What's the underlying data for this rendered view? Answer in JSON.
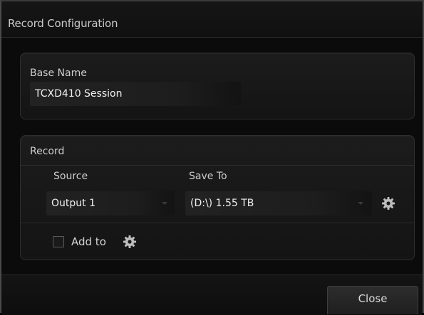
{
  "window": {
    "title": "Record Configuration"
  },
  "base_name": {
    "label": "Base Name",
    "value": "TCXD410 Session"
  },
  "record": {
    "section_label": "Record",
    "source": {
      "label": "Source",
      "value": "Output 1"
    },
    "save_to": {
      "label": "Save To",
      "value": "(D:\\) 1.55 TB"
    },
    "settings_icon": "gear-icon",
    "add_to": {
      "label": "Add to",
      "checked": false,
      "settings_icon": "gear-icon"
    }
  },
  "footer": {
    "close_label": "Close"
  },
  "colors": {
    "background": "#0b0b0b",
    "panel": "#1a1a1a",
    "text": "#cfcfcf",
    "value_text": "#f0f0f0"
  }
}
